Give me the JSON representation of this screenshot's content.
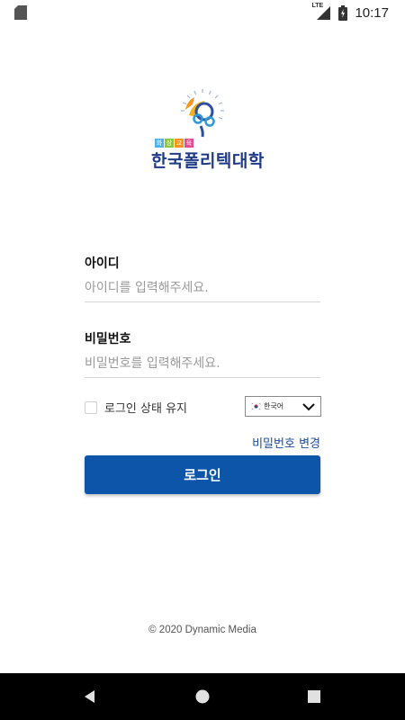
{
  "status_bar": {
    "time": "10:17",
    "network": "LTE",
    "icons": [
      "sd-card-icon",
      "signal-icon",
      "battery-icon"
    ]
  },
  "logo": {
    "badge": [
      "화",
      "상",
      "교",
      "육"
    ],
    "badge_colors": [
      "#4fb4e8",
      "#8dc63f",
      "#f7941d",
      "#ec4a8f"
    ],
    "name": "한국폴리텍대학",
    "brand_color": "#1f3b86"
  },
  "form": {
    "id_label": "아이디",
    "id_placeholder": "아이디를 입력해주세요.",
    "password_label": "비밀번호",
    "password_placeholder": "비밀번호를 입력해주세요.",
    "remember_label": "로그인 상태 유지",
    "language_value": "한국어",
    "change_password_link": "비밀번호 변경",
    "login_button": "로그인",
    "accent_color": "#0d55a8"
  },
  "footer": {
    "copyright": "© 2020 Dynamic Media"
  },
  "nav_bar": {
    "buttons": [
      "back-icon",
      "home-icon",
      "recents-icon"
    ]
  }
}
